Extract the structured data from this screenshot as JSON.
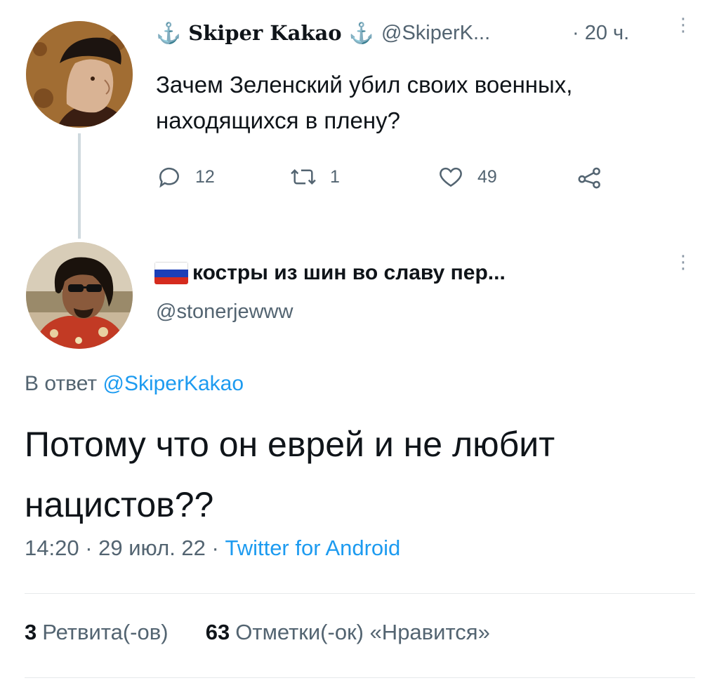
{
  "original_tweet": {
    "display_name": "Skiper Kakao",
    "name_prefix_icon": "anchor-icon",
    "name_suffix_icon": "anchor-icon",
    "handle": "@SkiperK...",
    "time": "· 20 ч.",
    "text": "Зачем Зеленский убил своих военных, находящихся в плену?",
    "actions": {
      "replies": "12",
      "retweets": "1",
      "likes": "49"
    }
  },
  "reply_tweet": {
    "display_name": "костры из шин во славу пер...",
    "flag": "russian-flag-icon",
    "handle": "@stonerjewww",
    "reply_to_prefix": "В ответ",
    "reply_to_mention": "@SkiperKakao",
    "text": "Потому что он еврей и не любит нацистов??",
    "time": "14:20 · 29 июл. 22 ·",
    "source": "Twitter for Android",
    "stats": {
      "retweets_count": "3",
      "retweets_label": "Ретвита(-ов)",
      "likes_count": "63",
      "likes_label": "Отметки(-ок) «Нравится»"
    }
  },
  "colors": {
    "accent": "#1d9bf0",
    "secondary_text": "#536471",
    "primary_text": "#0f1419"
  }
}
